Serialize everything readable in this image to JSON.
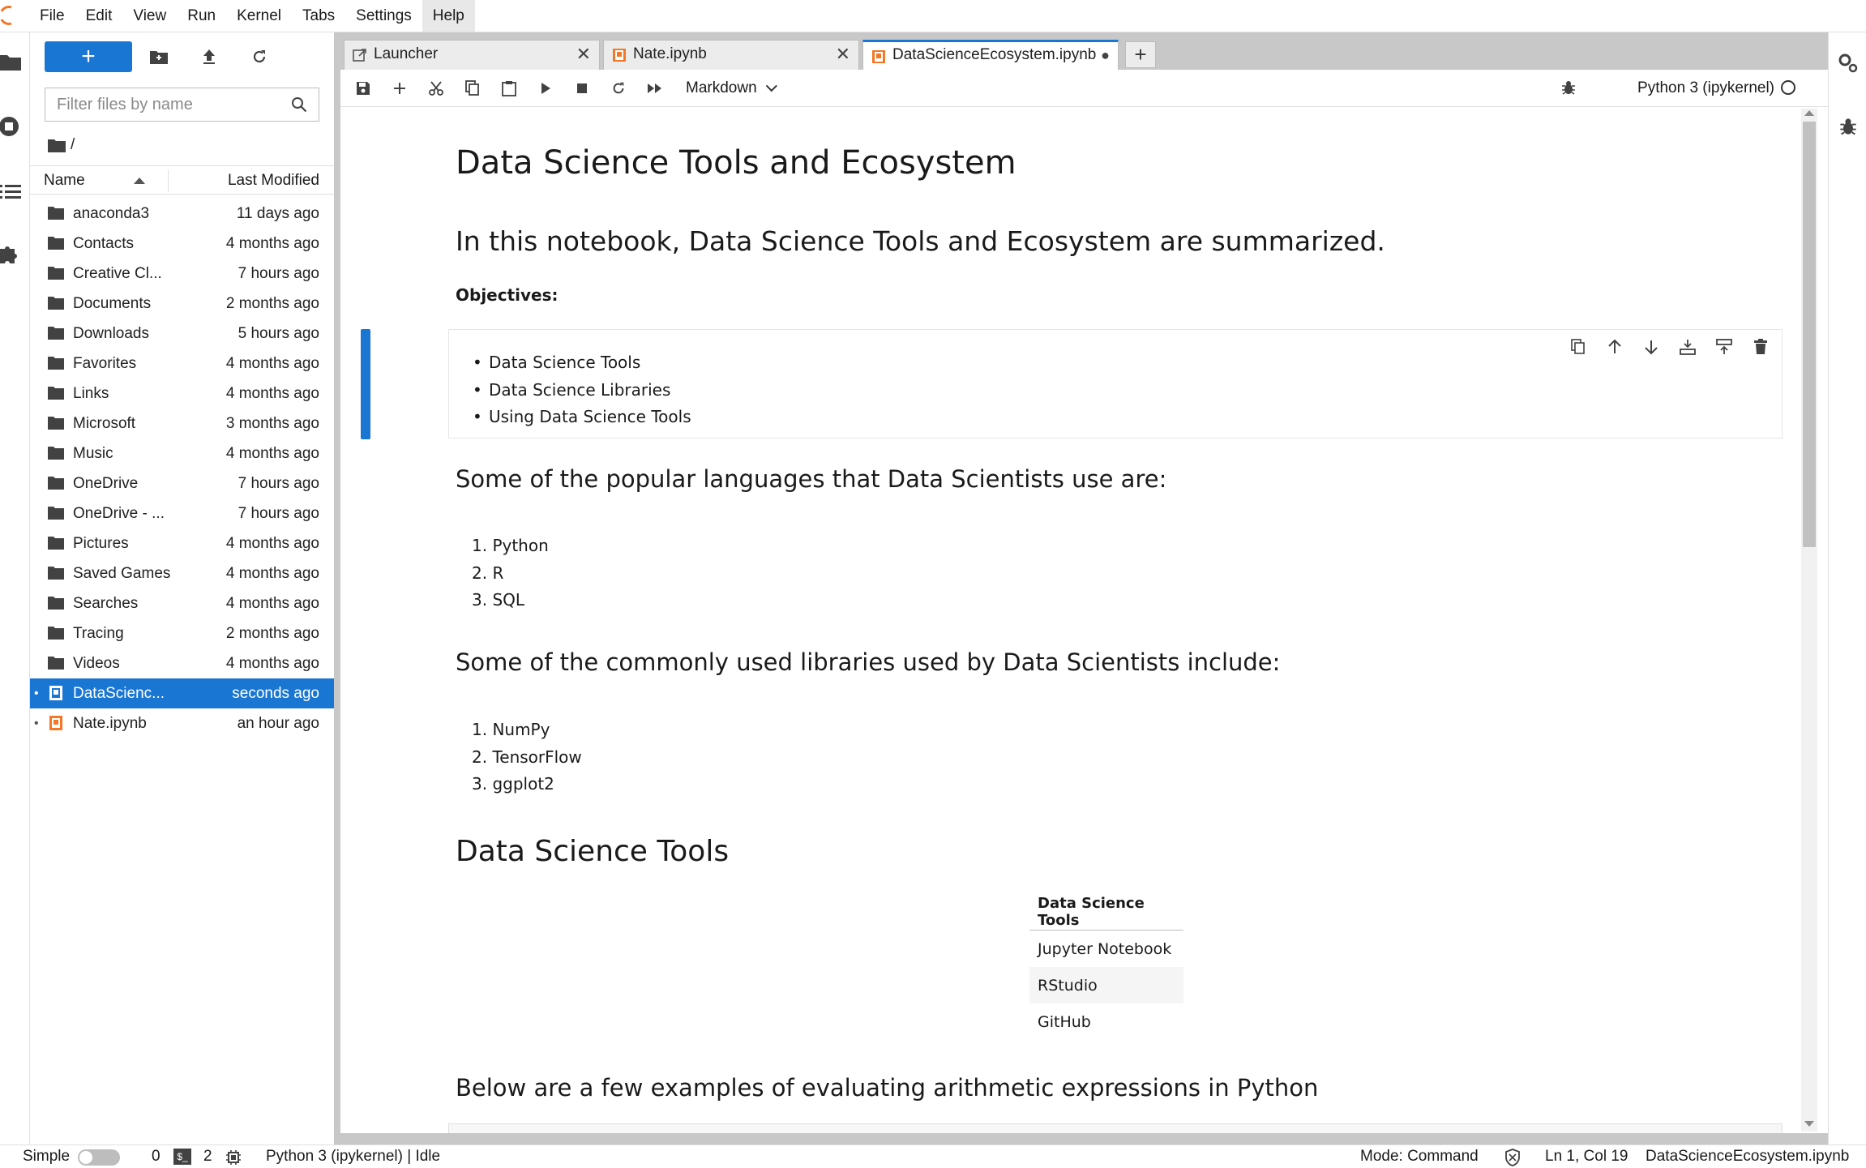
{
  "menubar": {
    "items": [
      "File",
      "Edit",
      "View",
      "Run",
      "Kernel",
      "Tabs",
      "Settings",
      "Help"
    ],
    "active": "Help",
    "accent_color": "#f37726"
  },
  "filebrowser": {
    "new_button_label": "+",
    "filter_placeholder": "Filter files by name",
    "path": "/",
    "columns": {
      "name": "Name",
      "modified": "Last Modified"
    },
    "items": [
      {
        "name": "anaconda3",
        "modified": "11 days ago",
        "type": "folder"
      },
      {
        "name": "Contacts",
        "modified": "4 months ago",
        "type": "folder"
      },
      {
        "name": "Creative Cl...",
        "modified": "7 hours ago",
        "type": "folder"
      },
      {
        "name": "Documents",
        "modified": "2 months ago",
        "type": "folder"
      },
      {
        "name": "Downloads",
        "modified": "5 hours ago",
        "type": "folder"
      },
      {
        "name": "Favorites",
        "modified": "4 months ago",
        "type": "folder"
      },
      {
        "name": "Links",
        "modified": "4 months ago",
        "type": "folder"
      },
      {
        "name": "Microsoft",
        "modified": "3 months ago",
        "type": "folder"
      },
      {
        "name": "Music",
        "modified": "4 months ago",
        "type": "folder"
      },
      {
        "name": "OneDrive",
        "modified": "7 hours ago",
        "type": "folder"
      },
      {
        "name": "OneDrive - ...",
        "modified": "7 hours ago",
        "type": "folder"
      },
      {
        "name": "Pictures",
        "modified": "4 months ago",
        "type": "folder"
      },
      {
        "name": "Saved Games",
        "modified": "4 months ago",
        "type": "folder"
      },
      {
        "name": "Searches",
        "modified": "4 months ago",
        "type": "folder"
      },
      {
        "name": "Tracing",
        "modified": "2 months ago",
        "type": "folder"
      },
      {
        "name": "Videos",
        "modified": "4 months ago",
        "type": "folder"
      },
      {
        "name": "DataScienc...",
        "modified": "seconds ago",
        "type": "notebook",
        "selected": true,
        "running": true
      },
      {
        "name": "Nate.ipynb",
        "modified": "an hour ago",
        "type": "notebook",
        "running": true
      }
    ],
    "selection_color": "#1976d2"
  },
  "tabs": [
    {
      "label": "Launcher",
      "icon": "launcher-icon",
      "close": "✕"
    },
    {
      "label": "Nate.ipynb",
      "icon": "notebook-icon",
      "close": "✕"
    },
    {
      "label": "DataScienceEcosystem.ipynb",
      "icon": "notebook-icon",
      "active": true,
      "unsaved_dot": "●"
    }
  ],
  "tab_add_label": "+",
  "notebook_toolbar": {
    "cell_type": "Markdown",
    "kernel": "Python 3 (ipykernel)"
  },
  "notebook": {
    "title": "Data Science Tools and Ecosystem",
    "intro": "In this notebook, Data Science Tools and Ecosystem are summarized.",
    "objectives_label": "Objectives:",
    "objectives": [
      "Data Science Tools",
      "Data Science Libraries",
      "Using Data Science Tools"
    ],
    "languages_heading": "Some of the popular languages that Data Scientists use are:",
    "languages": [
      "1. Python",
      "2. R",
      "3. SQL"
    ],
    "libraries_heading": "Some of the commonly used libraries used by Data Scientists include:",
    "libraries": [
      "1. NumPy",
      "2. TensorFlow",
      "3. ggplot2"
    ],
    "tools_heading": "Data Science Tools",
    "tools_table": {
      "header": "Data Science Tools",
      "rows": [
        "Jupyter Notebook",
        "RStudio",
        "GitHub"
      ]
    },
    "arith_heading": "Below are a few examples of evaluating arithmetic expressions in Python"
  },
  "statusbar": {
    "simple_label": "Simple",
    "terminals_count": "0",
    "kernels_count": "2",
    "kernel_status": "Python 3 (ipykernel) | Idle",
    "mode": "Mode: Command",
    "cursor": "Ln 1, Col 19",
    "filename": "DataScienceEcosystem.ipynb"
  }
}
